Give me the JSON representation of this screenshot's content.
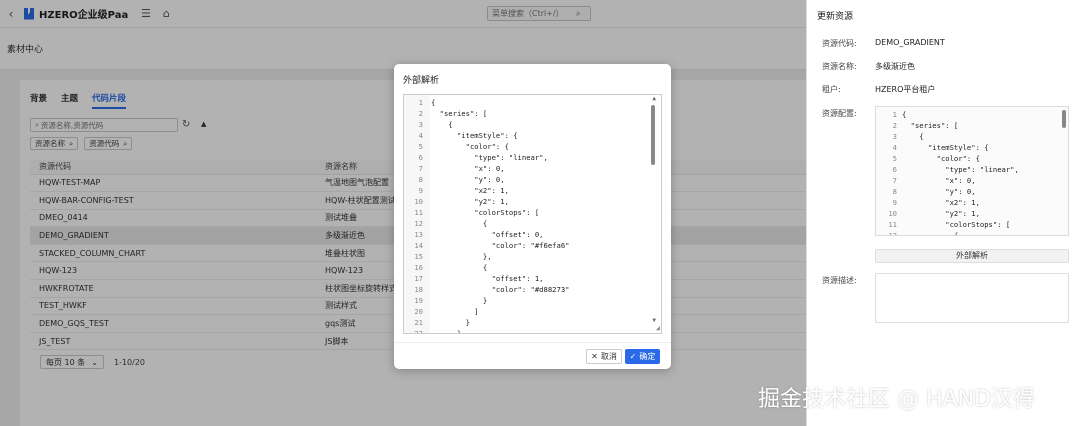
{
  "topbar": {
    "back_icon": "chevron-left-icon",
    "app_title": "HZERO企业级PaaS...",
    "menu_icon": "menu-icon",
    "home_icon": "home-icon",
    "menu_search_placeholder": "菜单搜索（Ctrl+/）"
  },
  "page": {
    "breadcrumb": "素材中心"
  },
  "tabs": [
    {
      "label": "背景",
      "active": false
    },
    {
      "label": "主题",
      "active": false
    },
    {
      "label": "代码片段",
      "active": true
    }
  ],
  "search": {
    "placeholder": "资源名称,资源代码"
  },
  "filters": [
    {
      "label": "资源名称"
    },
    {
      "label": "资源代码"
    }
  ],
  "table": {
    "headers": [
      "资源代码",
      "资源名称"
    ],
    "rows": [
      [
        "HQW-TEST-MAP",
        "气温地图气泡配置"
      ],
      [
        "HQW-BAR-CONFIG-TEST",
        "HQW-柱状配置测试"
      ],
      [
        "DMEO_0414",
        "测试堆叠"
      ],
      [
        "DEMO_GRADIENT",
        "多级渐近色"
      ],
      [
        "STACKED_COLUMN_CHART",
        "堆叠柱状图"
      ],
      [
        "HQW-123",
        "HQW-123"
      ],
      [
        "HWKFROTATE",
        "柱状图坐标旋转样式"
      ],
      [
        "TEST_HWKF",
        "测试样式"
      ],
      [
        "DEMO_GQS_TEST",
        "gqs测试"
      ],
      [
        "JS_TEST",
        "JS脚本"
      ]
    ],
    "selected_index": 3
  },
  "pager": {
    "page_size": "每页 10 条",
    "range": "1-10/20"
  },
  "right_panel": {
    "title": "更新资源",
    "fields": [
      {
        "label": "资源代码:",
        "value": "DEMO_GRADIENT"
      },
      {
        "label": "资源名称:",
        "value": "多级渐近色"
      },
      {
        "label": "租户:",
        "value": "HZERO平台租户"
      }
    ],
    "config_label": "资源配置:",
    "config_lines": [
      "{",
      "  \"series\": [",
      "    {",
      "      \"itemStyle\": {",
      "        \"color\": {",
      "          \"type\": \"linear\",",
      "          \"x\": 0,",
      "          \"y\": 0,",
      "          \"x2\": 1,",
      "          \"y2\": 1,",
      "          \"colorStops\": [",
      "            {"
    ],
    "parse_button": "外部解析",
    "desc_label": "资源描述:"
  },
  "modal": {
    "title": "外部解析",
    "code_lines": [
      "{",
      "  \"series\": [",
      "    {",
      "      \"itemStyle\": {",
      "        \"color\": {",
      "          \"type\": \"linear\",",
      "          \"x\": 0,",
      "          \"y\": 0,",
      "          \"x2\": 1,",
      "          \"y2\": 1,",
      "          \"colorStops\": [",
      "            {",
      "              \"offset\": 0,",
      "              \"color\": \"#f6efa6\"",
      "            },",
      "            {",
      "              \"offset\": 1,",
      "              \"color\": \"#d88273\"",
      "            }",
      "          ]",
      "        }",
      "      },"
    ],
    "cancel_label": "取消",
    "ok_label": "确定"
  },
  "watermark": "掘金技术社区 @ HAND汉得",
  "colors": {
    "accent": "#2a6ae9"
  }
}
